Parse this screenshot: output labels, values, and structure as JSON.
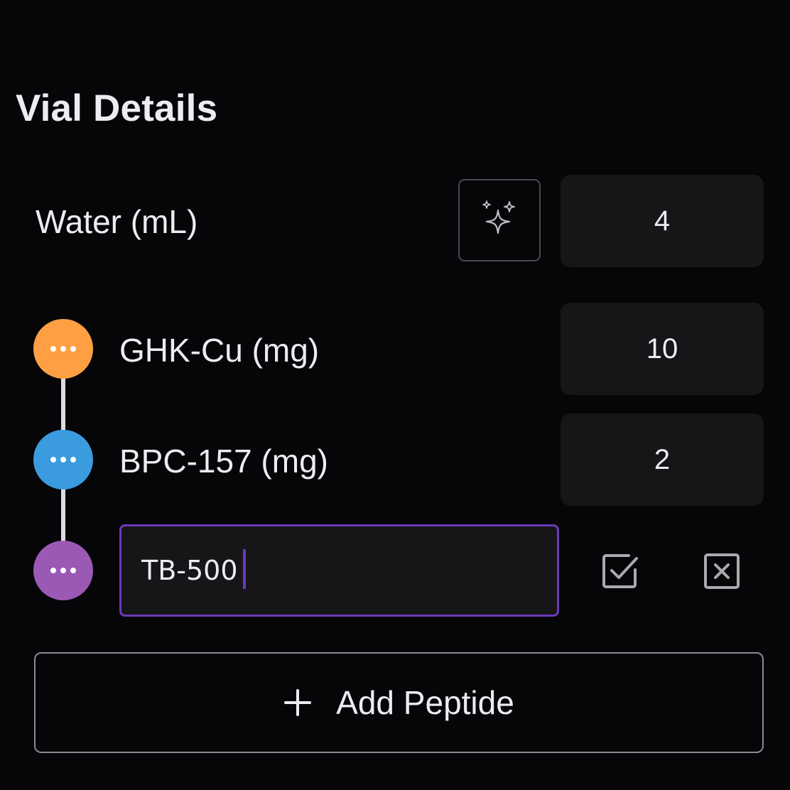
{
  "section": {
    "title": "Vial Details"
  },
  "water": {
    "label": "Water (mL)",
    "value": "4",
    "auto_icon": "sparkles-icon"
  },
  "peptides": [
    {
      "label": "GHK-Cu (mg)",
      "value": "10",
      "color": "#FF9F43",
      "menu_icon": "ellipsis-icon"
    },
    {
      "label": "BPC-157 (mg)",
      "value": "2",
      "color": "#3A9BDF",
      "menu_icon": "ellipsis-icon"
    }
  ],
  "new_peptide": {
    "value": "TB-500",
    "color": "#9B59B6",
    "confirm_icon": "checkbox-check-icon",
    "cancel_icon": "checkbox-x-icon"
  },
  "add_button": {
    "icon": "plus-icon",
    "label": "Add Peptide"
  },
  "colors": {
    "background": "#060608",
    "field": "#161619",
    "accent": "#6B3AB8"
  }
}
